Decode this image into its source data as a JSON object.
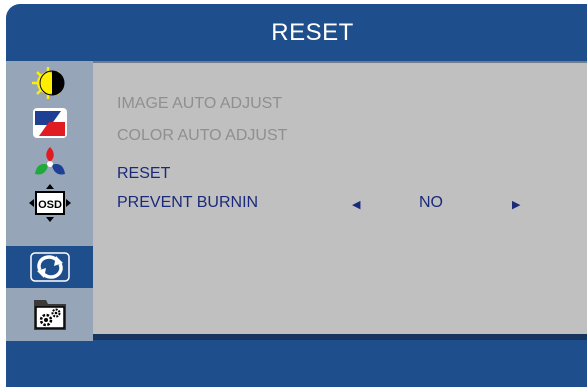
{
  "header": {
    "title": "RESET"
  },
  "sidebar": {
    "items": [
      {
        "icon": "brightness-contrast-icon"
      },
      {
        "icon": "color-icon"
      },
      {
        "icon": "rgb-icon"
      },
      {
        "icon": "osd-icon",
        "label": "OSD"
      },
      {
        "icon": "reset-icon",
        "active": true
      },
      {
        "icon": "settings-icon"
      }
    ]
  },
  "menu": {
    "image_auto_adjust": "IMAGE AUTO ADJUST",
    "color_auto_adjust": "COLOR AUTO ADJUST",
    "reset": "RESET",
    "prevent_burnin": {
      "label": "PREVENT BURNIN",
      "value": "NO",
      "left_arrow": "◀",
      "right_arrow": "▶"
    }
  },
  "colors": {
    "frame": "#1f4e8c",
    "sidebar": "#96a5b8",
    "content": "#c0c0c0",
    "text_enabled": "#1a2a7a",
    "text_disabled": "#8f8f8f"
  }
}
